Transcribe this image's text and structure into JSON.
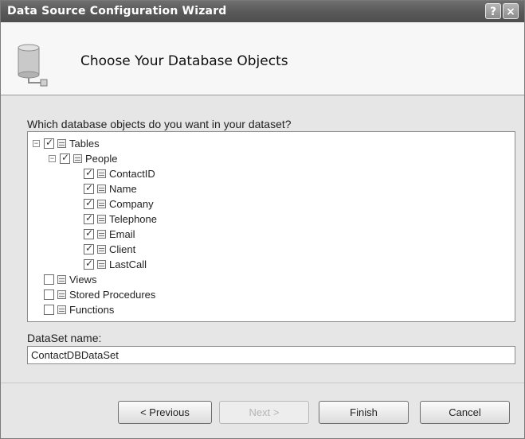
{
  "window": {
    "title": "Data Source Configuration Wizard",
    "help_glyph": "?",
    "close_glyph": "×"
  },
  "header": {
    "title": "Choose Your Database Objects",
    "icon": "database-plug-icon"
  },
  "tree": {
    "prompt": "Which database objects do you want in your dataset?",
    "tables_label": "Tables",
    "people_label": "People",
    "columns": [
      {
        "label": "ContactID",
        "checked": true
      },
      {
        "label": "Name",
        "checked": true
      },
      {
        "label": "Company",
        "checked": true
      },
      {
        "label": "Telephone",
        "checked": true
      },
      {
        "label": "Email",
        "checked": true
      },
      {
        "label": "Client",
        "checked": true
      },
      {
        "label": "LastCall",
        "checked": true
      }
    ],
    "views_label": "Views",
    "stored_procedures_label": "Stored Procedures",
    "functions_label": "Functions"
  },
  "dataset": {
    "label": "DataSet name:",
    "value": "ContactDBDataSet"
  },
  "buttons": {
    "previous": "< Previous",
    "next": "Next >",
    "finish": "Finish",
    "cancel": "Cancel"
  }
}
